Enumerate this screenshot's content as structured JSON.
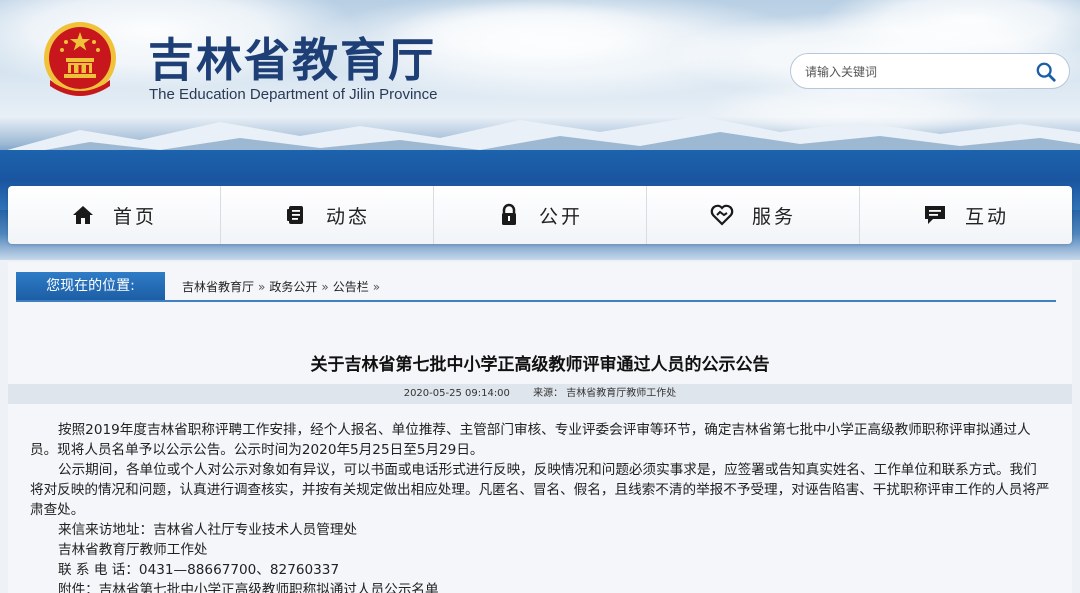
{
  "header": {
    "title": "吉林省教育厅",
    "subtitle": "The Education Department of Jilin Province",
    "emblem_icon": "national-emblem-icon"
  },
  "search": {
    "placeholder": "请输入关键词",
    "icon": "search-icon"
  },
  "nav": {
    "items": [
      {
        "label": "首页",
        "icon": "home-icon"
      },
      {
        "label": "动态",
        "icon": "news-icon"
      },
      {
        "label": "公开",
        "icon": "lock-icon"
      },
      {
        "label": "服务",
        "icon": "handshake-icon"
      },
      {
        "label": "互动",
        "icon": "chat-icon"
      }
    ]
  },
  "breadcrumb": {
    "tag": "您现在的位置:",
    "items": [
      "吉林省教育厅",
      "政务公开",
      "公告栏"
    ],
    "separator": "»"
  },
  "article": {
    "title": "关于吉林省第七批中小学正高级教师评审通过人员的公示公告",
    "date": "2020-05-25 09:14:00",
    "source": "来源：  吉林省教育厅教师工作处",
    "paragraph1": "按照2019年度吉林省职称评聘工作安排，经个人报名、单位推荐、主管部门审核、专业评委会评审等环节，确定吉林省第七批中小学正高级教师职称评审拟通过人员。现将人员名单予以公示公告。公示时间为2020年5月25日至5月29日。",
    "paragraph2": "公示期间，各单位或个人对公示对象如有异议，可以书面或电话形式进行反映，反映情况和问题必须实事求是，应签署或告知真实姓名、工作单位和联系方式。我们将对反映的情况和问题，认真进行调查核实，并按有关规定做出相应处理。凡匿名、冒名、假名，且线索不清的举报不予受理，对诬告陷害、干扰职称评审工作的人员将严肃查处。",
    "contact_address": "来信来访地址：吉林省人社厅专业技术人员管理处",
    "contact_office": "吉林省教育厅教师工作处",
    "contact_phone": "联 系 电 话：0431—88667700、82760337",
    "attachment": "附件：吉林省第七批中小学正高级教师职称拟通过人员公示名单"
  },
  "colors": {
    "title_blue": "#1e3f75",
    "accent_blue": "#2f7cc7",
    "emblem_red": "#c8161d",
    "emblem_gold": "#f0c23a"
  }
}
